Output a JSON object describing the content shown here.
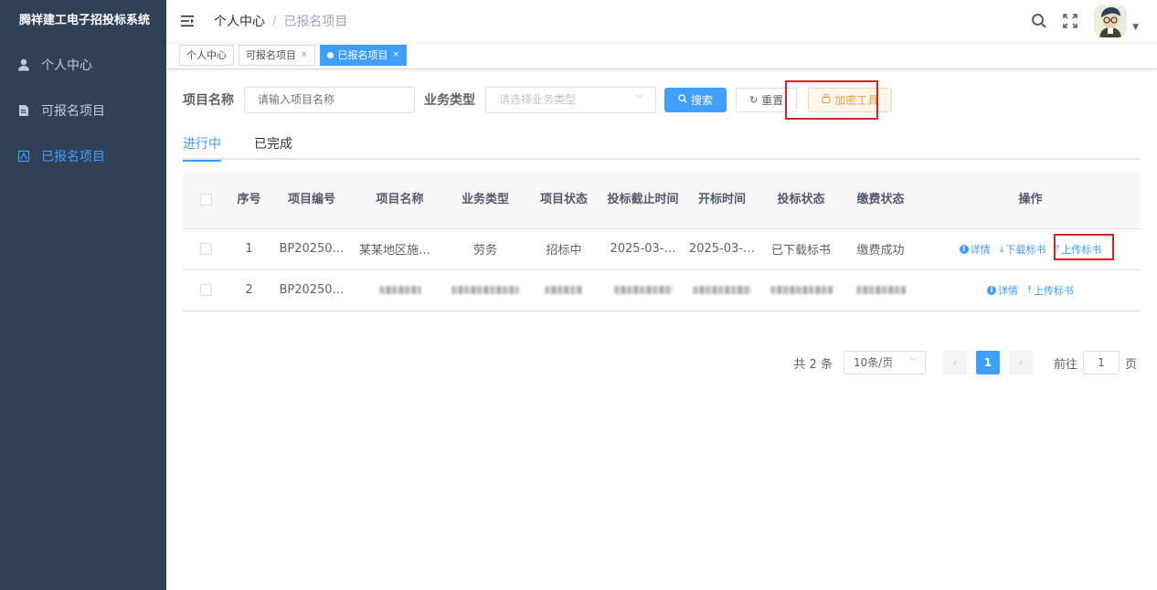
{
  "app": {
    "title": "腾祥建工电子招投标系统"
  },
  "sidebar": {
    "items": [
      {
        "label": "个人中心",
        "icon": "user-icon",
        "active": false
      },
      {
        "label": "可报名项目",
        "icon": "document-icon",
        "active": false
      },
      {
        "label": "已报名项目",
        "icon": "list-icon",
        "active": true
      }
    ]
  },
  "navbar": {
    "breadcrumb": {
      "root": "个人中心",
      "sep": "/",
      "current": "已报名项目"
    }
  },
  "tags": [
    {
      "label": "个人中心",
      "closable": false,
      "active": false
    },
    {
      "label": "可报名项目",
      "closable": true,
      "active": false
    },
    {
      "label": "已报名项目",
      "closable": true,
      "active": true
    }
  ],
  "filter": {
    "name_label": "项目名称",
    "name_placeholder": "请输入项目名称",
    "type_label": "业务类型",
    "type_placeholder": "请选择业务类型",
    "search_label": "搜索",
    "reset_label": "重置",
    "encrypt_label": "加密工具"
  },
  "tabs": [
    {
      "label": "进行中",
      "active": true
    },
    {
      "label": "已完成",
      "active": false
    }
  ],
  "table": {
    "headers": [
      "序号",
      "项目编号",
      "项目名称",
      "业务类型",
      "项目状态",
      "投标截止时间",
      "开标时间",
      "投标状态",
      "缴费状态",
      "操作"
    ],
    "rows": [
      {
        "index": "1",
        "code": "BP20250…",
        "name": "某某地区施工…",
        "type": "劳务",
        "status": "招标中",
        "deadline": "2025-03-…",
        "open_time": "2025-03-…",
        "bid_status": "已下载标书",
        "pay_status": "缴费成功",
        "ops": {
          "detail": "详情",
          "download": "下载标书",
          "upload": "上传标书"
        }
      },
      {
        "index": "2",
        "code": "BP20250…",
        "ops": {
          "detail": "详情",
          "upload": "上传标书"
        }
      }
    ]
  },
  "pagination": {
    "total_text": "共 2 条",
    "page_size": "10条/页",
    "current_page": "1",
    "goto_label": "前往",
    "goto_value": "1",
    "page_unit": "页"
  },
  "colors": {
    "sidebar_bg": "#304156",
    "primary": "#409eff",
    "warning": "#e6a23c",
    "highlight": "#e02020"
  }
}
